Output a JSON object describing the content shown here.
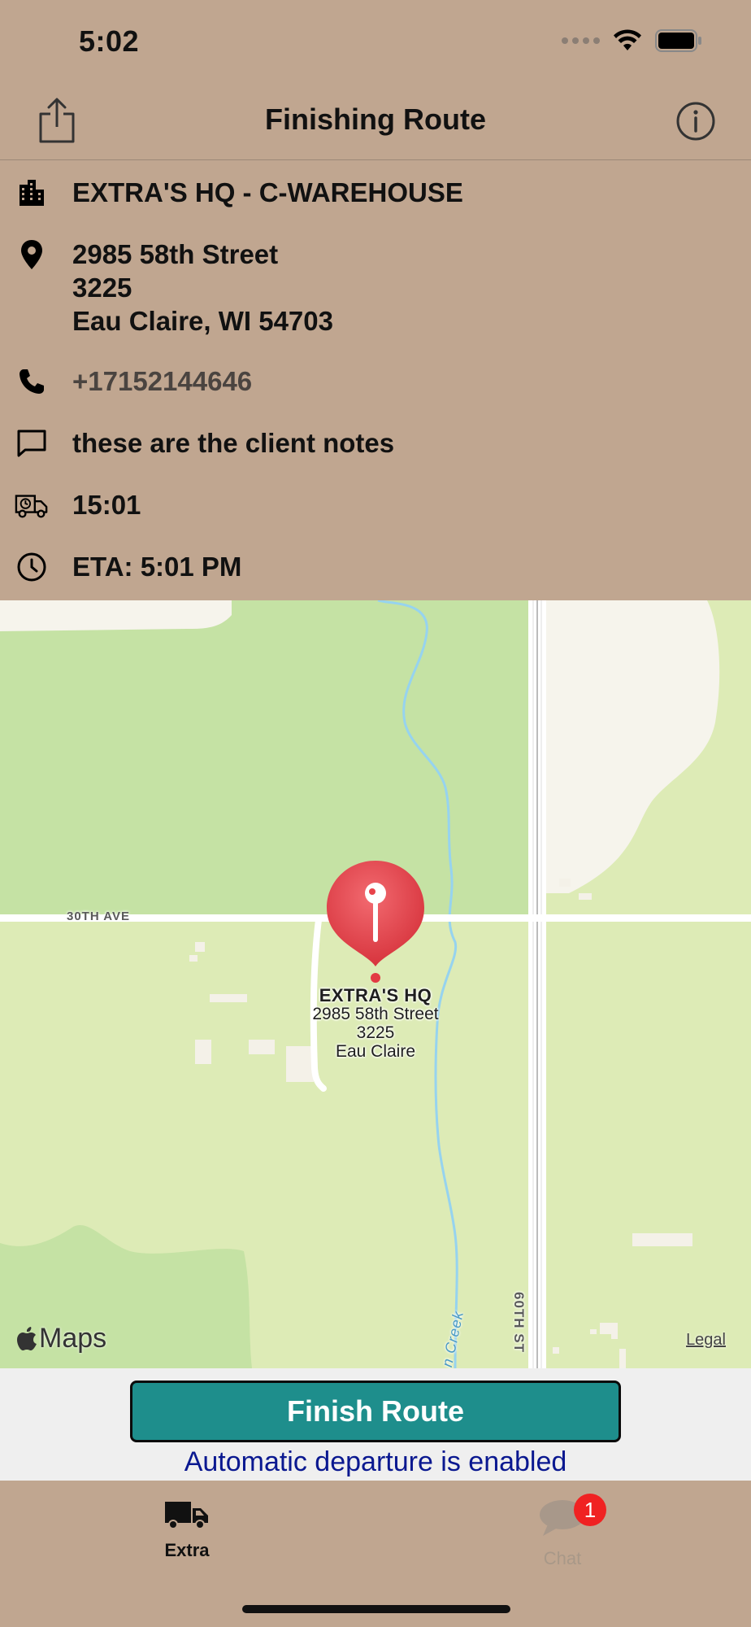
{
  "status_bar": {
    "time": "5:02"
  },
  "nav": {
    "title": "Finishing Route",
    "share_icon": "share-icon",
    "info_icon": "info-icon"
  },
  "details": {
    "client_name": "EXTRA'S HQ - C-WAREHOUSE",
    "address_line1": "2985 58th Street",
    "address_line2": "3225",
    "address_line3": "Eau Claire, WI 54703",
    "phone": "+17152144646",
    "notes": "these are the client notes",
    "delivery_time": "15:01",
    "eta": "ETA: 5:01 PM"
  },
  "map": {
    "pin_title": "EXTRA'S HQ",
    "pin_line1": "2985 58th Street",
    "pin_line2": "3225",
    "pin_line3": "Eau Claire",
    "road_30th": "30TH AVE",
    "road_60th": "60TH ST",
    "creek": "n Creek",
    "maps_brand": "Maps",
    "legal": "Legal",
    "pin_color": "#E8434B"
  },
  "footer": {
    "finish_button": "Finish Route",
    "auto_departure": "Automatic departure is enabled",
    "button_color": "#1E8E8C"
  },
  "tabs": [
    {
      "label": "Extra",
      "icon": "truck-icon"
    },
    {
      "label": "Chat",
      "icon": "chat-bubble-icon",
      "badge": "1"
    }
  ]
}
